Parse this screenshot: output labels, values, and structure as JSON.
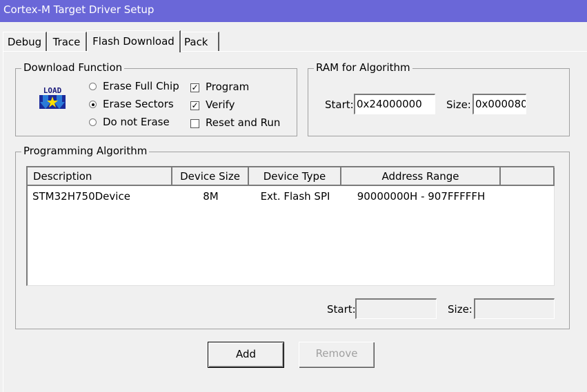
{
  "window": {
    "title": "Cortex-M Target Driver Setup"
  },
  "tabs": [
    {
      "label": "Debug",
      "active": false
    },
    {
      "label": "Trace",
      "active": false
    },
    {
      "label": "Flash Download",
      "active": true
    },
    {
      "label": "Pack",
      "active": false
    }
  ],
  "download_function": {
    "legend": "Download Function",
    "icon_text": "LOAD",
    "radios": [
      {
        "label": "Erase Full Chip",
        "checked": false
      },
      {
        "label": "Erase Sectors",
        "checked": true
      },
      {
        "label": "Do not Erase",
        "checked": false
      }
    ],
    "checks": [
      {
        "label": "Program",
        "checked": true
      },
      {
        "label": "Verify",
        "checked": true
      },
      {
        "label": "Reset and Run",
        "checked": false
      }
    ]
  },
  "ram": {
    "legend": "RAM for Algorithm",
    "start_label": "Start:",
    "start_value": "0x24000000",
    "size_label": "Size:",
    "size_value": "0x000080"
  },
  "algorithm": {
    "legend": "Programming Algorithm",
    "columns": [
      "Description",
      "Device Size",
      "Device Type",
      "Address Range"
    ],
    "rows": [
      {
        "description": "STM32H750Device",
        "device_size": "8M",
        "device_type": "Ext. Flash SPI",
        "address_range": "90000000H - 907FFFFFH"
      }
    ],
    "start_label": "Start:",
    "start_value": "",
    "size_label": "Size:",
    "size_value": ""
  },
  "buttons": {
    "add": "Add",
    "remove": "Remove"
  },
  "colors": {
    "titlebar": "#6a67d8",
    "face": "#f0f0f0",
    "disabled_text": "#a0a0a0"
  }
}
